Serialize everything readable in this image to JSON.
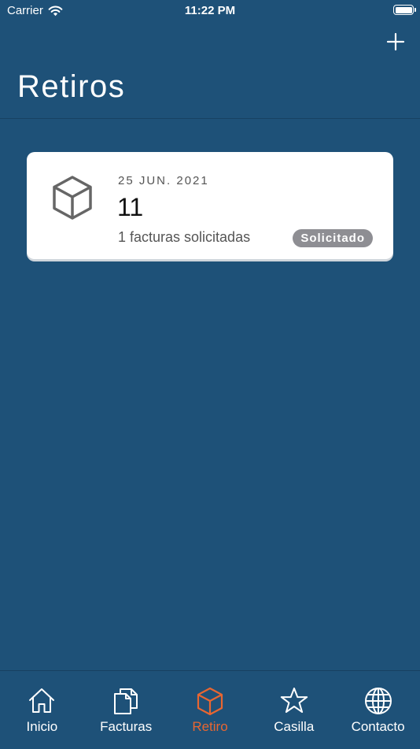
{
  "status_bar": {
    "carrier": "Carrier",
    "time": "11:22 PM"
  },
  "header": {
    "title": "Retiros",
    "add_icon": "plus-icon"
  },
  "retiros": [
    {
      "date": "25 JUN. 2021",
      "number": "11",
      "subtitle": "1 facturas solicitadas",
      "status": "Solicitado",
      "icon": "box-icon"
    }
  ],
  "tabs": [
    {
      "label": "Inicio",
      "icon": "home-icon",
      "active": false
    },
    {
      "label": "Facturas",
      "icon": "documents-icon",
      "active": false
    },
    {
      "label": "Retiro",
      "icon": "box-icon",
      "active": true
    },
    {
      "label": "Casilla",
      "icon": "star-icon",
      "active": false
    },
    {
      "label": "Contacto",
      "icon": "globe-icon",
      "active": false
    }
  ],
  "colors": {
    "background": "#1e5178",
    "accent": "#e86631",
    "card": "#ffffff",
    "badge": "#8e8e93"
  }
}
